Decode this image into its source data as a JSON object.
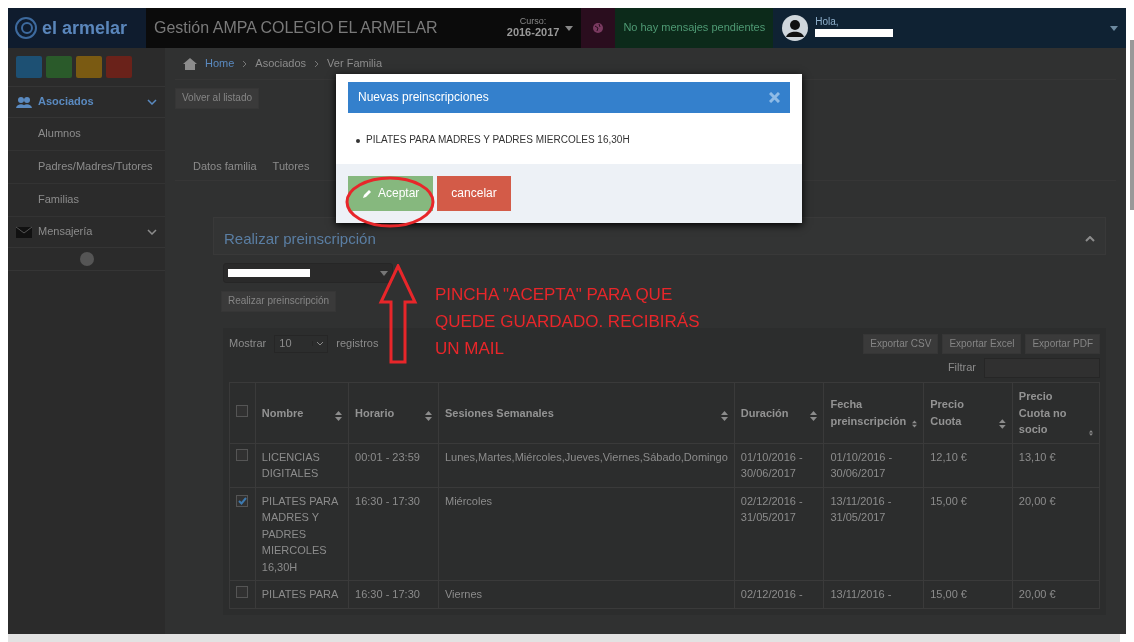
{
  "header": {
    "brand": "el armelar",
    "title": "Gestión AMPA COLEGIO EL ARMELAR",
    "course_label": "Curso:",
    "course": "2016-2017",
    "messages": "No hay mensajes pendientes",
    "greeting": "Hola,"
  },
  "sidebar": {
    "items": [
      {
        "label": "Asociados",
        "expanded": true,
        "children": [
          {
            "label": "Alumnos"
          },
          {
            "label": "Padres/Madres/Tutores"
          },
          {
            "label": "Familias"
          }
        ]
      },
      {
        "label": "Mensajería",
        "expanded": false
      }
    ]
  },
  "breadcrumb": [
    "Home",
    "Asociados",
    "Ver Familia"
  ],
  "back_button": "Volver al listado",
  "tabs": [
    "Datos familia",
    "Tutores"
  ],
  "panel": {
    "title": "Realizar preinscripción",
    "submit": "Realizar preinscripción"
  },
  "table_controls": {
    "show_label": "Mostrar",
    "page_size": "10",
    "records_label": "registros",
    "exports": [
      "Exportar CSV",
      "Exportar Excel",
      "Exportar PDF"
    ],
    "filter_label": "Filtrar"
  },
  "table": {
    "columns": [
      "Nombre",
      "Horario",
      "Sesiones Semanales",
      "Duración",
      "Fecha preinscripción",
      "Precio Cuota",
      "Precio Cuota no socio"
    ],
    "all_checked": false,
    "rows": [
      {
        "checked": false,
        "cells": [
          "LICENCIAS DIGITALES",
          "00:01 - 23:59",
          "Lunes,Martes,Miércoles,Jueves,Viernes,Sábado,Domingo",
          "01/10/2016 - 30/06/2017",
          "01/10/2016 - 30/06/2017",
          "12,10 €",
          "13,10 €"
        ]
      },
      {
        "checked": true,
        "cells": [
          "PILATES PARA MADRES Y PADRES MIERCOLES 16,30H",
          "16:30 - 17:30",
          "Miércoles",
          "02/12/2016 - 31/05/2017",
          "13/11/2016 - 31/05/2017",
          "15,00 €",
          "20,00 €"
        ]
      },
      {
        "checked": false,
        "cells": [
          "PILATES PARA",
          "16:30 - 17:30",
          "Viernes",
          "02/12/2016 -",
          "13/11/2016 -",
          "15,00 €",
          "20,00 €"
        ]
      }
    ]
  },
  "modal": {
    "title": "Nuevas preinscripciones",
    "items": [
      "PILATES PARA MADRES Y PADRES MIERCOLES 16,30H"
    ],
    "accept": "Aceptar",
    "cancel": "cancelar"
  },
  "annotation": {
    "text": "PINCHA \"ACEPTA\" PARA QUE QUEDE GUARDADO. RECIBIRÁS UN MAIL"
  }
}
